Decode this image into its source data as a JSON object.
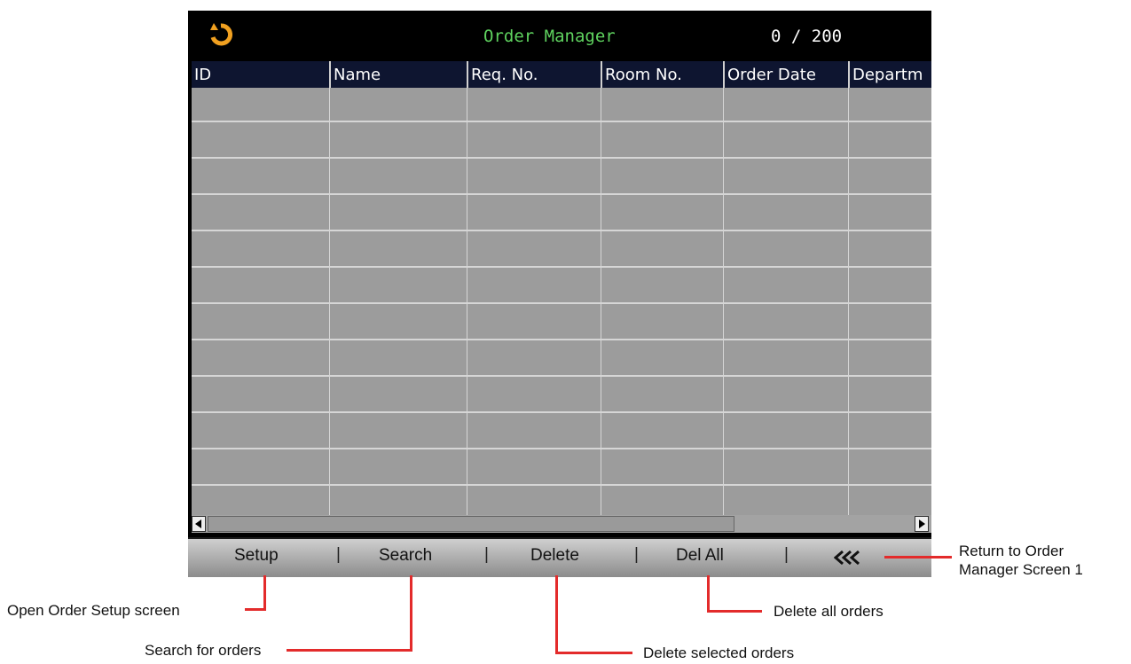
{
  "screen": {
    "title": "Order Manager",
    "count": "0 / 200",
    "columns": [
      "ID",
      "Name",
      "Req. No.",
      "Room No.",
      "Order Date",
      "Departm"
    ],
    "toolbar": {
      "setup": "Setup",
      "search": "Search",
      "delete": "Delete",
      "del_all": "Del All",
      "back": "«‹",
      "separator": "|"
    }
  },
  "annotations": {
    "setup": "Open Order Setup screen",
    "search": "Search for orders",
    "delete": "Delete selected orders",
    "del_all": "Delete all orders",
    "back_line1": "Return to Order",
    "back_line2": "Manager Screen 1"
  },
  "colors": {
    "title": "#5fd35f",
    "header_bg": "#0e1530",
    "grid_bg": "#9c9c9c",
    "callout": "#e32b2b",
    "back_icon": "#f0a020"
  },
  "icons": {
    "back": "return-arrow-icon"
  }
}
